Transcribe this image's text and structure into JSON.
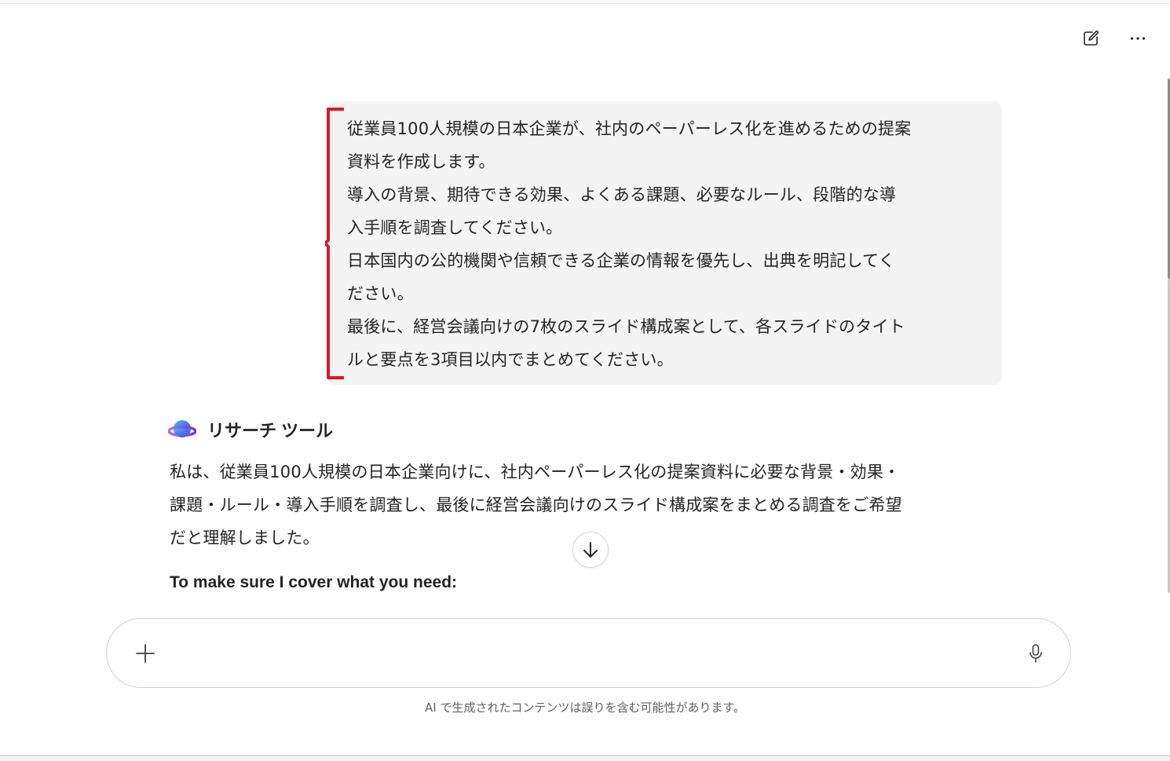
{
  "header": {
    "new_chat_icon": "compose-icon",
    "more_icon": "more-horizontal-icon"
  },
  "user_message": {
    "lines": [
      "従業員100人規模の日本企業が、社内のペーパーレス化を進めるための提案",
      "資料を作成します。",
      "導入の背景、期待できる効果、よくある課題、必要なルール、段階的な導",
      "入手順を調査してください。",
      "日本国内の公的機関や信頼できる企業の情報を優先し、出典を明記してく",
      "ださい。",
      "最後に、経営会議向けの7枚のスライド構成案として、各スライドのタイト",
      "ルと要点を3項目以内でまとめてください。"
    ],
    "highlight_color": "#e81123"
  },
  "agent": {
    "name": "リサーチ ツール",
    "icon": "research-tool-icon",
    "body_lines": [
      "私は、従業員100人規模の日本企業向けに、社内ペーパーレス化の提案資料に必要な背景・効果・",
      "課題・ルール・導入手順を調査し、最後に経営会議向けのスライド構成案をまとめる調査をご希望",
      "だと理解しました。"
    ],
    "subheading": "To make sure I cover what you need:"
  },
  "composer": {
    "value": "",
    "placeholder": "",
    "add_icon": "plus-icon",
    "mic_icon": "microphone-icon"
  },
  "disclaimer": "AI で生成されたコンテンツは誤りを含む可能性があります。"
}
